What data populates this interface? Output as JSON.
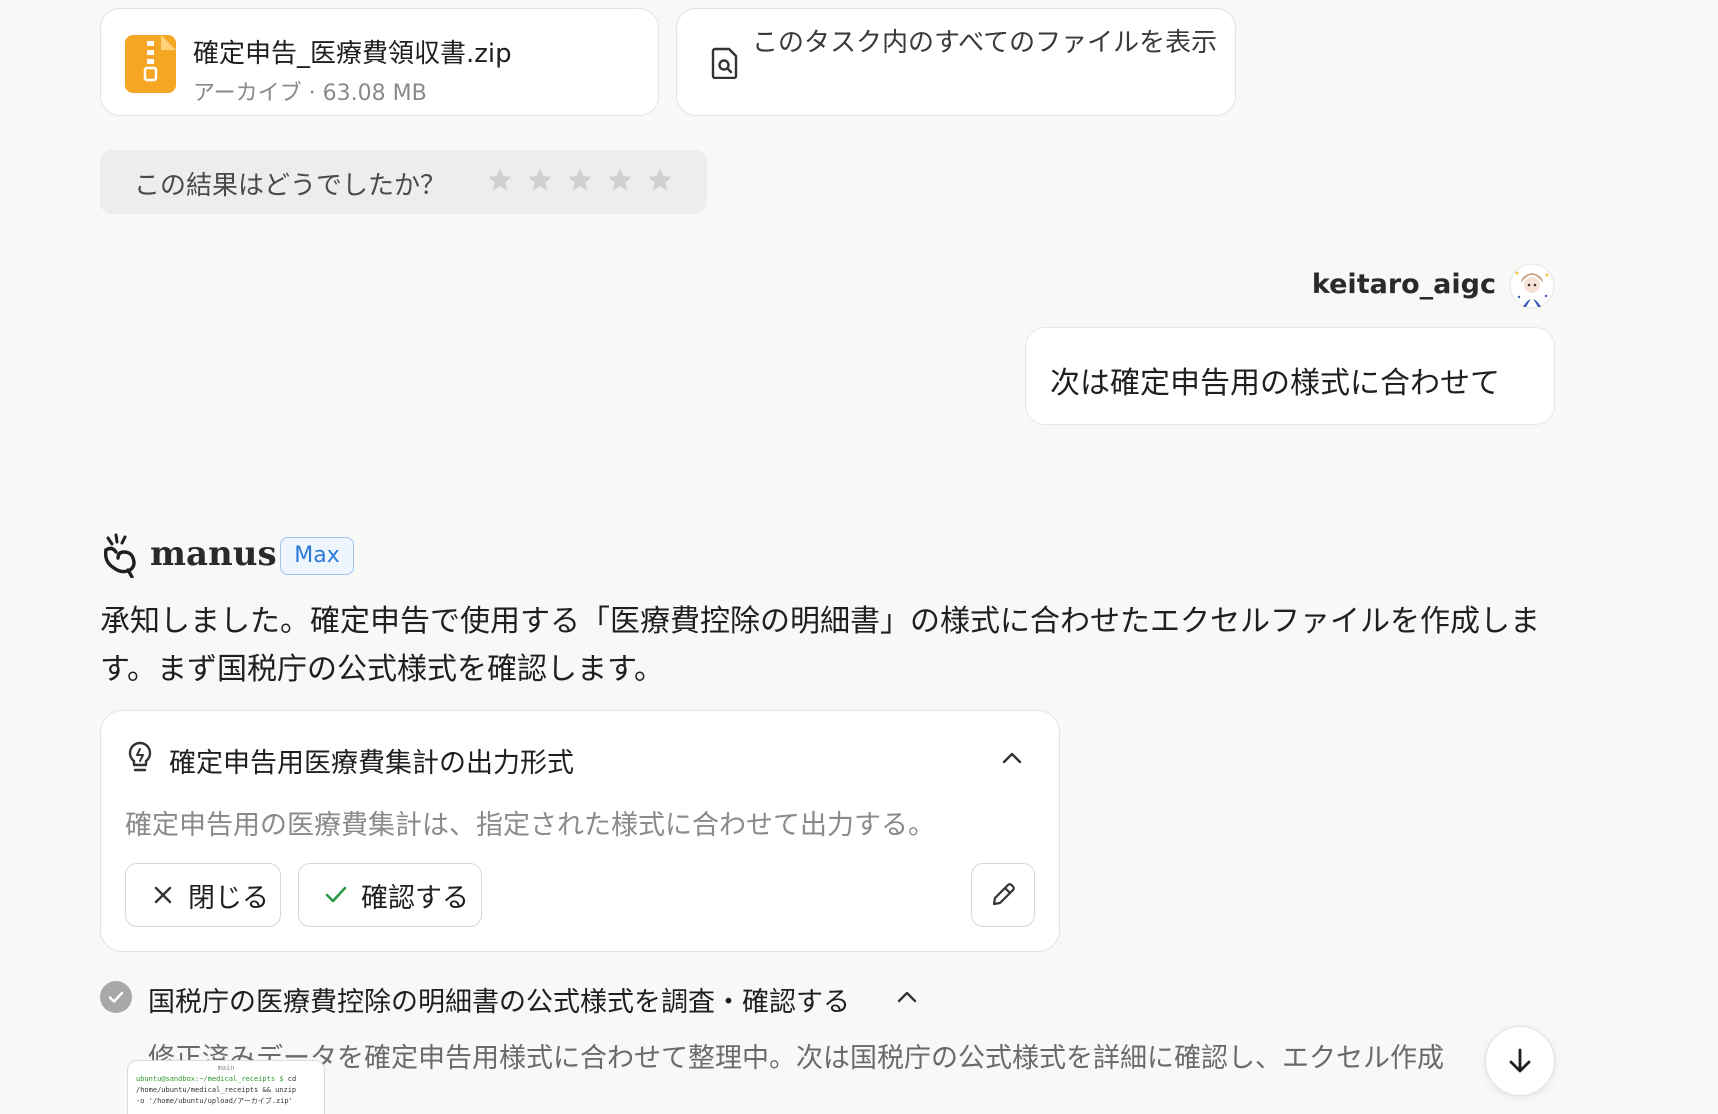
{
  "files": {
    "zip": {
      "name": "確定申告_医療費領収書.zip",
      "meta": "アーカイブ · 63.08 MB"
    },
    "view_all": "このタスク内のすべてのファイルを表示"
  },
  "rating": {
    "label": "この結果はどうでしたか？",
    "stars": 5
  },
  "user": {
    "name": "keitaro_aigc",
    "message": "次は確定申告用の様式に合わせて"
  },
  "assistant": {
    "name": "manus",
    "badge": "Max",
    "message": "承知しました。確定申告で使用する「医療費控除の明細書」の様式に合わせたエクセルファイルを作成します。まず国税庁の公式様式を確認します。"
  },
  "suggestion": {
    "title": "確定申告用医療費集計の出力形式",
    "body": "確定申告用の医療費集計は、指定された様式に合わせて出力する。",
    "close_label": "閉じる",
    "confirm_label": "確認する"
  },
  "step": {
    "title": "国税庁の医療費控除の明細書の公式様式を調査・確認する",
    "description": "修正済みデータを確定申告用様式に合わせて整理中。次は国税庁の公式様式を詳細に確認し、エクセル作成"
  },
  "terminal": {
    "tab": "main",
    "prompt": "ubuntu@sandbox:~/medical_receipts $",
    "cmd1": " cd",
    "line2": "/home/ubuntu/medical_receipts && unzip",
    "line3": "-o '/home/ubuntu/upload/アーカイブ.zip'"
  },
  "colors": {
    "background": "#f8f8f7",
    "zip_icon": "#f5a623",
    "badge_blue": "#2a7ad6",
    "confirm_check": "#2f9a4a"
  }
}
